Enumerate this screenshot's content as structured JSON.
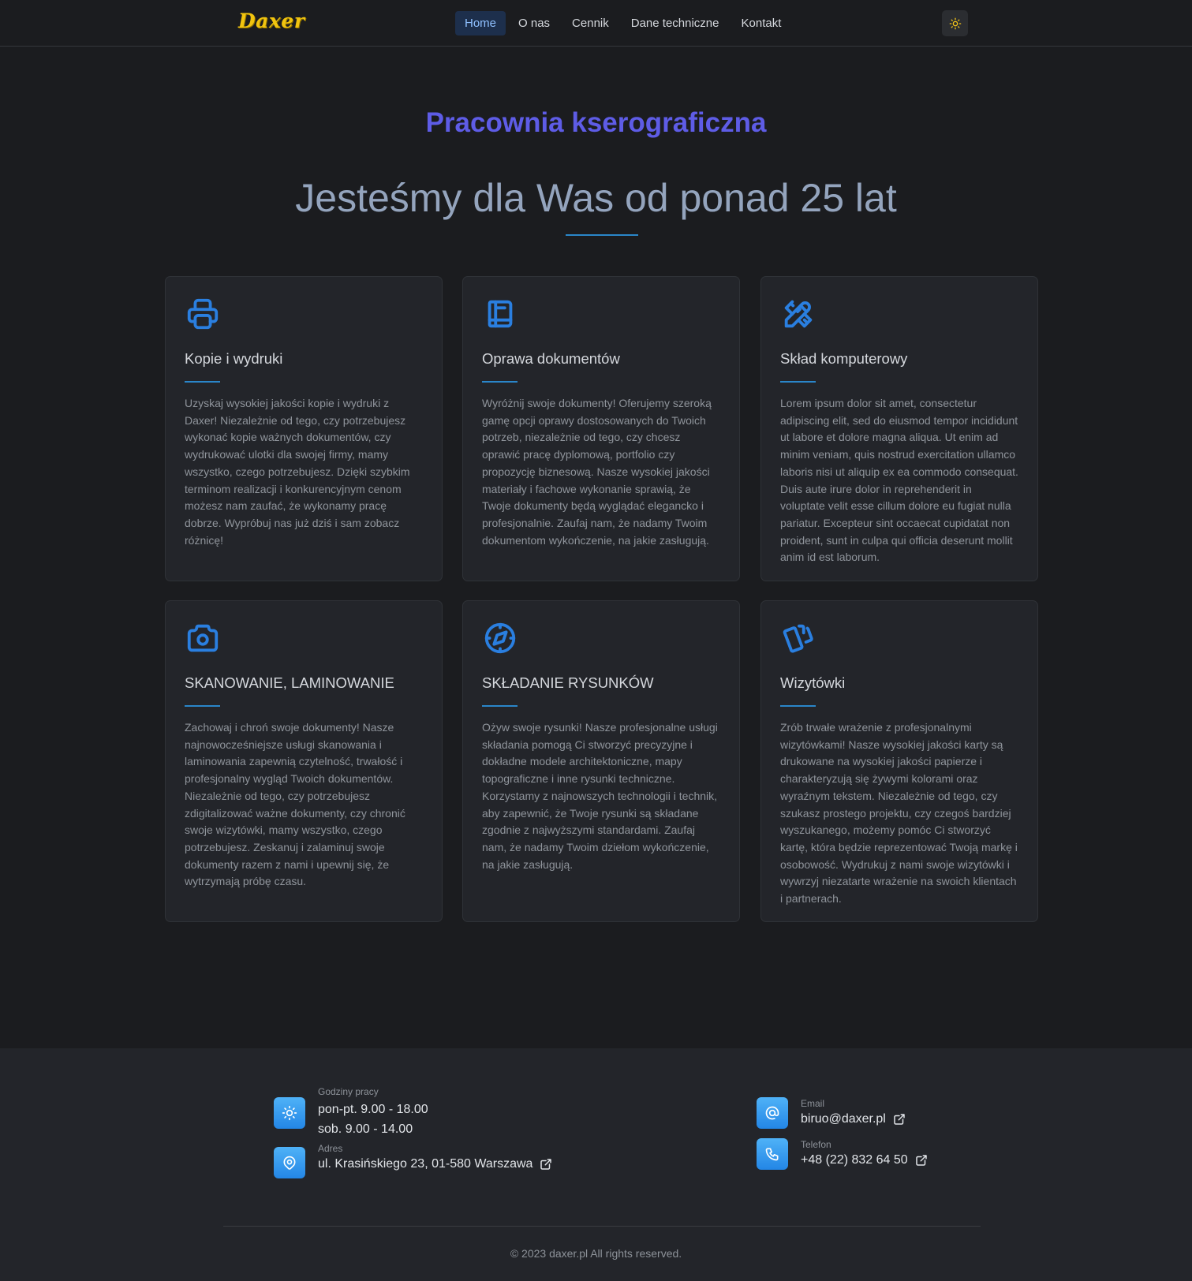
{
  "header": {
    "logo": "Daxer",
    "nav": [
      "Home",
      "O nas",
      "Cennik",
      "Dane techniczne",
      "Kontakt"
    ],
    "active_nav": "Home"
  },
  "hero": {
    "subtitle": "Pracownia kserograficzna",
    "headline": "Jesteśmy dla Was od ponad 25 lat"
  },
  "cards": [
    {
      "icon": "printer-icon",
      "title": "Kopie i wydruki",
      "text": "Uzyskaj wysokiej jakości kopie i wydruki z Daxer! Niezależnie od tego, czy potrzebujesz wykonać kopie ważnych dokumentów, czy wydrukować ulotki dla swojej firmy, mamy wszystko, czego potrzebujesz. Dzięki szybkim terminom realizacji i konkurencyjnym cenom możesz nam zaufać, że wykonamy pracę dobrze. Wypróbuj nas już dziś i sam zobacz różnicę!"
    },
    {
      "icon": "book-icon",
      "title": "Oprawa dokumentów",
      "text": "Wyróżnij swoje dokumenty! Oferujemy szeroką gamę opcji oprawy dostosowanych do Twoich potrzeb, niezależnie od tego, czy chcesz oprawić pracę dyplomową, portfolio czy propozycję biznesową. Nasze wysokiej jakości materiały i fachowe wykonanie sprawią, że Twoje dokumenty będą wyglądać elegancko i profesjonalnie. Zaufaj nam, że nadamy Twoim dokumentom wykończenie, na jakie zasługują."
    },
    {
      "icon": "pencil-ruler-icon",
      "title": "Skład komputerowy",
      "text": "Lorem ipsum dolor sit amet, consectetur adipiscing elit, sed do eiusmod tempor incididunt ut labore et dolore magna aliqua. Ut enim ad minim veniam, quis nostrud exercitation ullamco laboris nisi ut aliquip ex ea commodo consequat. Duis aute irure dolor in reprehenderit in voluptate velit esse cillum dolore eu fugiat nulla pariatur. Excepteur sint occaecat cupidatat non proident, sunt in culpa qui officia deserunt mollit anim id est laborum."
    },
    {
      "icon": "camera-icon",
      "title": "SKANOWANIE, LAMINOWANIE",
      "text": "Zachowaj i chroń swoje dokumenty! Nasze najnowocześniejsze usługi skanowania i laminowania zapewnią czytelność, trwałość i profesjonalny wygląd Twoich dokumentów. Niezależnie od tego, czy potrzebujesz zdigitalizować ważne dokumenty, czy chronić swoje wizytówki, mamy wszystko, czego potrzebujesz. Zeskanuj i zalaminuj swoje dokumenty razem z nami i upewnij się, że wytrzymają próbę czasu."
    },
    {
      "icon": "compass-icon",
      "title": "SKŁADANIE RYSUNKÓW",
      "text": "Ożyw swoje rysunki! Nasze profesjonalne usługi składania pomogą Ci stworzyć precyzyjne i dokładne modele architektoniczne, mapy topograficzne i inne rysunki techniczne. Korzystamy z najnowszych technologii i technik, aby zapewnić, że Twoje rysunki są składane zgodnie z najwyższymi standardami. Zaufaj nam, że nadamy Twoim dziełom wykończenie, na jakie zasługują."
    },
    {
      "icon": "cards-icon",
      "title": "Wizytówki",
      "text": "Zrób trwałe wrażenie z profesjonalnymi wizytówkami! Nasze wysokiej jakości karty są drukowane na wysokiej jakości papierze i charakteryzują się żywymi kolorami oraz wyraźnym tekstem. Niezależnie od tego, czy szukasz prostego projektu, czy czegoś bardziej wyszukanego, możemy pomóc Ci stworzyć kartę, która będzie reprezentować Twoją markę i osobowość. Wydrukuj z nami swoje wizytówki i wywrzyj niezatarte wrażenie na swoich klientach i partnerach."
    }
  ],
  "footer": {
    "hours_label": "Godziny pracy",
    "hours_weekdays": "pon-pt. 9.00 - 18.00",
    "hours_saturday": "sob. 9.00 - 14.00",
    "address_label": "Adres",
    "address": "ul. Krasińskiego 23, 01-580 Warszawa",
    "email_label": "Email",
    "email": "biruo@daxer.pl",
    "phone_label": "Telefon",
    "phone": "+48 (22) 832 64 50",
    "copyright": "© 2023 daxer.pl All rights reserved."
  }
}
